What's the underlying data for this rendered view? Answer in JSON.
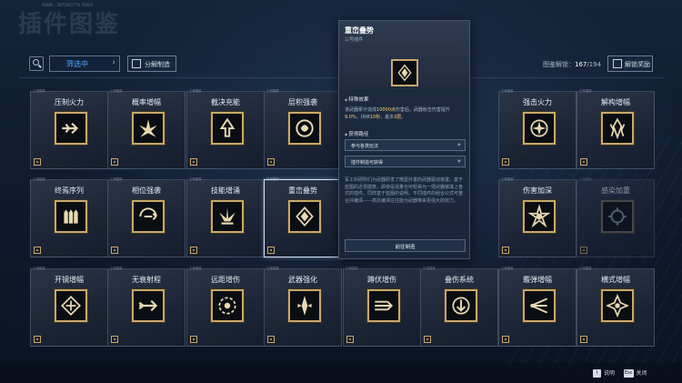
{
  "header": {
    "title": "插件图鉴",
    "player_id": "66885 · 2871067776 76929"
  },
  "toolbar": {
    "filter_label": "筛选中",
    "decompose_label": "分解制造",
    "codex_label": "图鉴解锁：",
    "codex_unlocked": "167",
    "codex_total": "/194",
    "reward_label": "解锁奖励"
  },
  "cards": [
    {
      "tag": "三号插件",
      "name": "压制火力",
      "icon": "arrow-burst-icon"
    },
    {
      "tag": "三号插件",
      "name": "概率增幅",
      "icon": "spike-cluster-icon"
    },
    {
      "tag": "三号插件",
      "name": "截决充能",
      "icon": "crown-up-icon"
    },
    {
      "tag": "三号插件",
      "name": "层积强袭",
      "icon": "shield-swirl-icon"
    },
    {
      "tag": "三号插件",
      "name": "强击火力",
      "icon": "target-star-icon"
    },
    {
      "tag": "三号插件",
      "name": "解构增幅",
      "icon": "crystal-cluster-icon"
    },
    {
      "tag": "三号插件",
      "name": "终焉序列",
      "icon": "bullets-icon"
    },
    {
      "tag": "三号插件",
      "name": "相位强袭",
      "icon": "phase-arrows-icon"
    },
    {
      "tag": "三号插件",
      "name": "技能增涌",
      "icon": "spike-fountain-icon"
    },
    {
      "tag": "三号插件",
      "name": "重峦叠势",
      "icon": "stacked-diamond-icon"
    },
    {
      "tag": "三号插件",
      "name": "伤害加深",
      "icon": "impact-star-icon"
    },
    {
      "tag": "三号插件",
      "name": "感染加重",
      "icon": "infection-icon"
    },
    {
      "tag": "三号插件",
      "name": "开镜增幅",
      "icon": "scope-diamond-icon"
    },
    {
      "tag": "三号插件",
      "name": "无衰射程",
      "icon": "long-arrow-icon"
    },
    {
      "tag": "三号插件",
      "name": "远距增伤",
      "icon": "range-ring-icon"
    },
    {
      "tag": "三号插件",
      "name": "武器强化",
      "icon": "weapon-spike-icon"
    },
    {
      "tag": "三号插件",
      "name": "蹲伏增伤",
      "icon": "dash-arrows-icon"
    },
    {
      "tag": "三号插件",
      "name": "叠伤系统",
      "icon": "down-arrow-ring-icon"
    },
    {
      "tag": "三号插件",
      "name": "霰弹增幅",
      "icon": "shotgun-spread-icon"
    },
    {
      "tag": "三号插件",
      "name": "横式增幅",
      "icon": "star-diamond-icon"
    }
  ],
  "popup": {
    "title": "重峦叠势",
    "subtitle": "三号插件",
    "effect_title": "特殊效果",
    "effect_text_1": "该武器累计造成",
    "effect_value_1": "10000点",
    "effect_text_2": "伤害后，武器射击伤害提升",
    "effect_value_2": "9.0%",
    "effect_text_3": "，持续",
    "effect_value_3": "10秒",
    "effect_text_4": "，最多",
    "effect_value_4": "3层",
    "effect_text_5": "。",
    "route_title": "获得路径",
    "routes": [
      "参与各类玩法",
      "插件制造可获得"
    ],
    "description": "军工科研所们为武器研发了微型外置的武器驱动装置。基于蓝图的近现建筑，即使是强量也可轻易为一把武器装填上各式的插件。同样基于蓝图的说明，不同插件的组合公式可整合并编译——高达编译往往能为武器带来更强大的效力。",
    "go_button": "前往制造"
  },
  "footer": {
    "help_key": "I",
    "help_label": "说明",
    "close_key": "Esc",
    "close_label": "关闭"
  }
}
